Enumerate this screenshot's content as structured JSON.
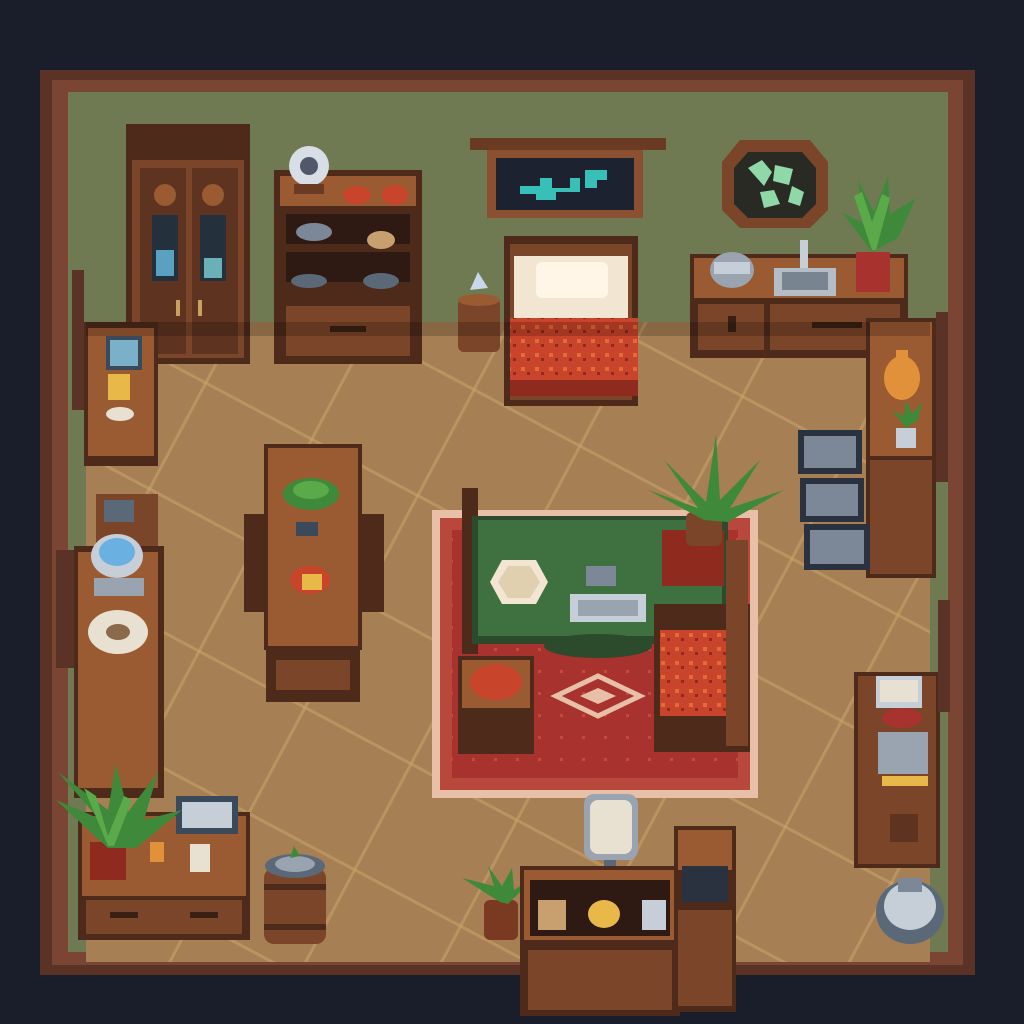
{
  "scene": {
    "kind": "top-down pixel-art room interior",
    "colors": {
      "background": "#1a1d2a",
      "outer_wall": "#5a3326",
      "wall_trim": "#7a4532",
      "wall_paint": "#6f7a52",
      "floor": "#b58a5c",
      "floor_light": "#c89a66",
      "floor_line": "#d9b071",
      "wood_dark": "#4e2a1b",
      "wood": "#7a4528",
      "wood_light": "#9a5a32",
      "rug_red": "#a8332e",
      "rug_border": "#e8c0a8",
      "table_green": "#3f7040",
      "cushion_red": "#c8442a",
      "plant_green": "#3f8a3a",
      "metal": "#9aa4b0",
      "screen_teal": "#38c0b8"
    },
    "objects": [
      {
        "id": "wardrobe",
        "icon": "wardrobe-icon"
      },
      {
        "id": "bookshelf",
        "icon": "shelf-icon"
      },
      {
        "id": "wall-map",
        "icon": "map-icon"
      },
      {
        "id": "wall-crystal-art",
        "icon": "crystal-icon"
      },
      {
        "id": "bed",
        "icon": "bed-icon"
      },
      {
        "id": "kitchen-counter",
        "icon": "sink-icon"
      },
      {
        "id": "dining-table",
        "icon": "table-icon"
      },
      {
        "id": "rug",
        "icon": "rug-icon"
      },
      {
        "id": "green-table",
        "icon": "table-icon"
      },
      {
        "id": "potted-plant",
        "icon": "plant-icon"
      },
      {
        "id": "stove",
        "icon": "stove-icon"
      },
      {
        "id": "barrel",
        "icon": "barrel-icon"
      },
      {
        "id": "desk",
        "icon": "desk-icon"
      },
      {
        "id": "mirror",
        "icon": "mirror-icon"
      },
      {
        "id": "cabinet",
        "icon": "cabinet-icon"
      },
      {
        "id": "storage-crates",
        "icon": "crate-icon"
      }
    ]
  }
}
